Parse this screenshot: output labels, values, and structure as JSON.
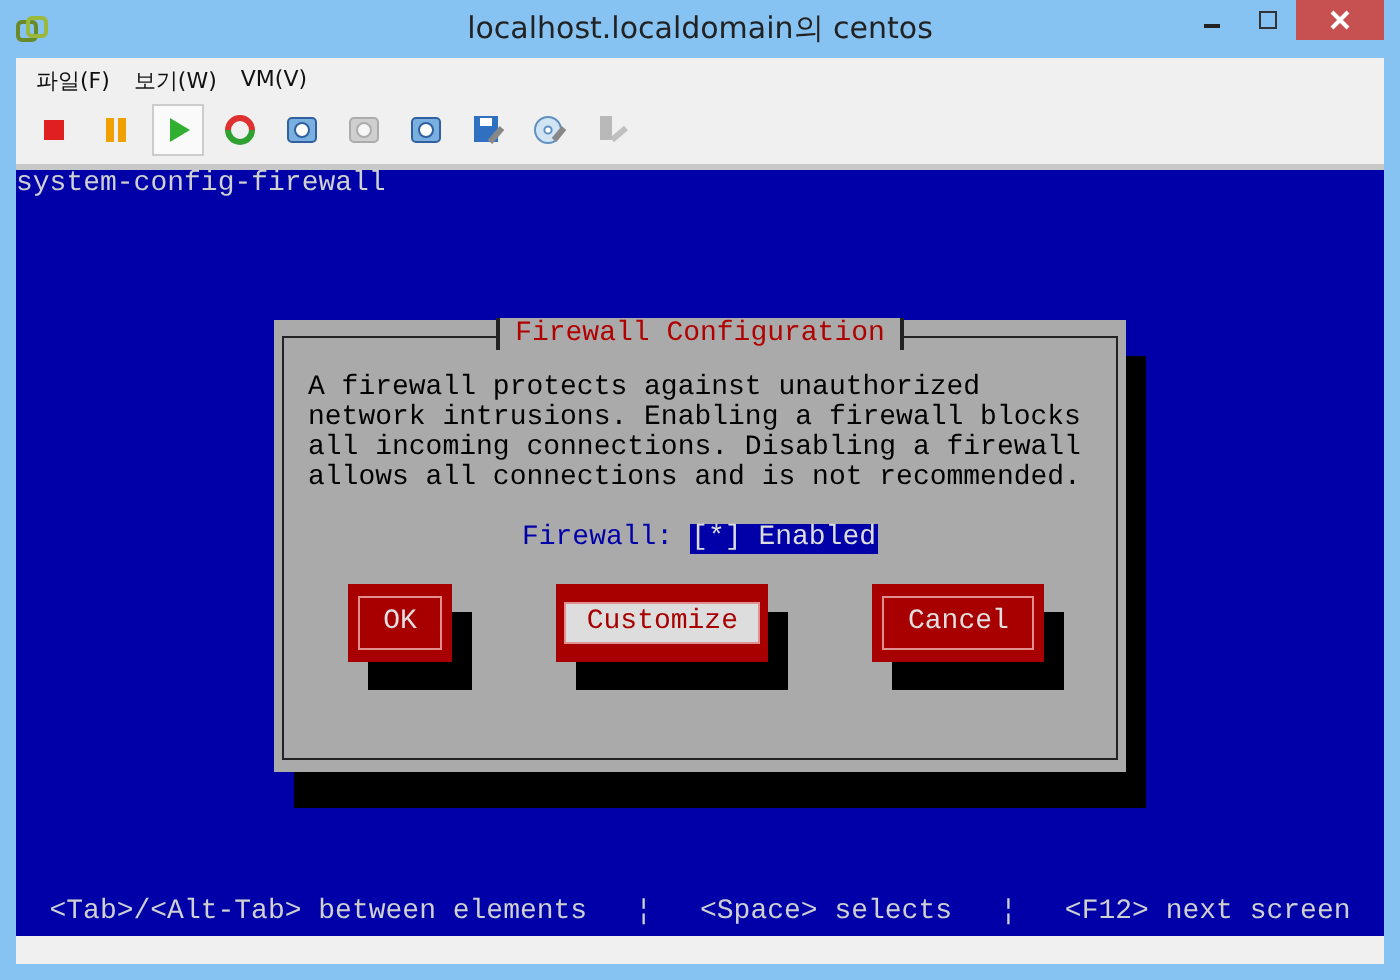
{
  "window": {
    "title": "localhost.localdomain의 centos"
  },
  "menu": [
    "파일(F)",
    "보기(W)",
    "VM(V)"
  ],
  "toolbar": [
    {
      "kind": "stop",
      "selected": false,
      "disabled": false
    },
    {
      "kind": "pause",
      "selected": false,
      "disabled": false
    },
    {
      "kind": "play",
      "selected": true,
      "disabled": false
    },
    {
      "kind": "reset",
      "selected": false,
      "disabled": false
    },
    {
      "kind": "snapshot",
      "selected": false,
      "disabled": false
    },
    {
      "kind": "snapshot",
      "selected": false,
      "disabled": true
    },
    {
      "kind": "snapshot",
      "selected": false,
      "disabled": false
    },
    {
      "kind": "disk",
      "selected": false,
      "disabled": false
    },
    {
      "kind": "cd",
      "selected": false,
      "disabled": false
    },
    {
      "kind": "usb",
      "selected": false,
      "disabled": true
    }
  ],
  "console": {
    "header": "system-config-firewall",
    "dialog": {
      "title": "Firewall Configuration",
      "message": [
        "A firewall protects against unauthorized",
        "network intrusions. Enabling a firewall blocks",
        "all incoming connections. Disabling a firewall",
        "allows all connections and is not recommended."
      ],
      "field_label": "Firewall:",
      "checkbox": {
        "text": "[*] Enabled",
        "selected": true
      },
      "buttons": [
        {
          "label": "OK",
          "selected": false
        },
        {
          "label": "Customize",
          "selected": true
        },
        {
          "label": "Cancel",
          "selected": false
        }
      ]
    },
    "hints": [
      "<Tab>/<Alt-Tab> between elements",
      "¦",
      "<Space> selects",
      "¦",
      "<F12> next screen"
    ]
  }
}
